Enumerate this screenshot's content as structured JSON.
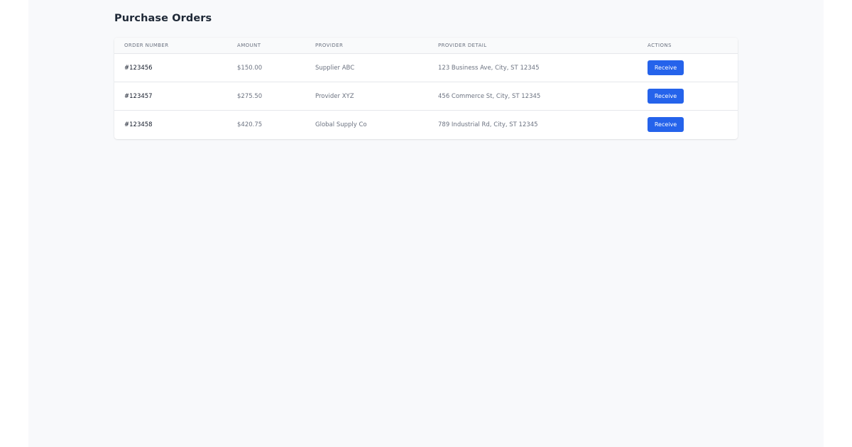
{
  "page": {
    "title": "Purchase Orders"
  },
  "table": {
    "headers": {
      "order_number": "Order Number",
      "amount": "Amount",
      "provider": "Provider",
      "provider_detail": "Provider Detail",
      "actions": "Actions"
    },
    "rows": [
      {
        "order_number": "#123456",
        "amount": "$150.00",
        "provider": "Supplier ABC",
        "provider_detail": "123 Business Ave, City, ST 12345",
        "action_label": "Receive"
      },
      {
        "order_number": "#123457",
        "amount": "$275.50",
        "provider": "Provider XYZ",
        "provider_detail": "456 Commerce St, City, ST 12345",
        "action_label": "Receive"
      },
      {
        "order_number": "#123458",
        "amount": "$420.75",
        "provider": "Global Supply Co",
        "provider_detail": "789 Industrial Rd, City, ST 12345",
        "action_label": "Receive"
      }
    ]
  },
  "colors": {
    "accent": "#2563eb",
    "page_background": "#f8f9fb",
    "title_text": "#1f2937",
    "muted_text": "#6b7280"
  }
}
